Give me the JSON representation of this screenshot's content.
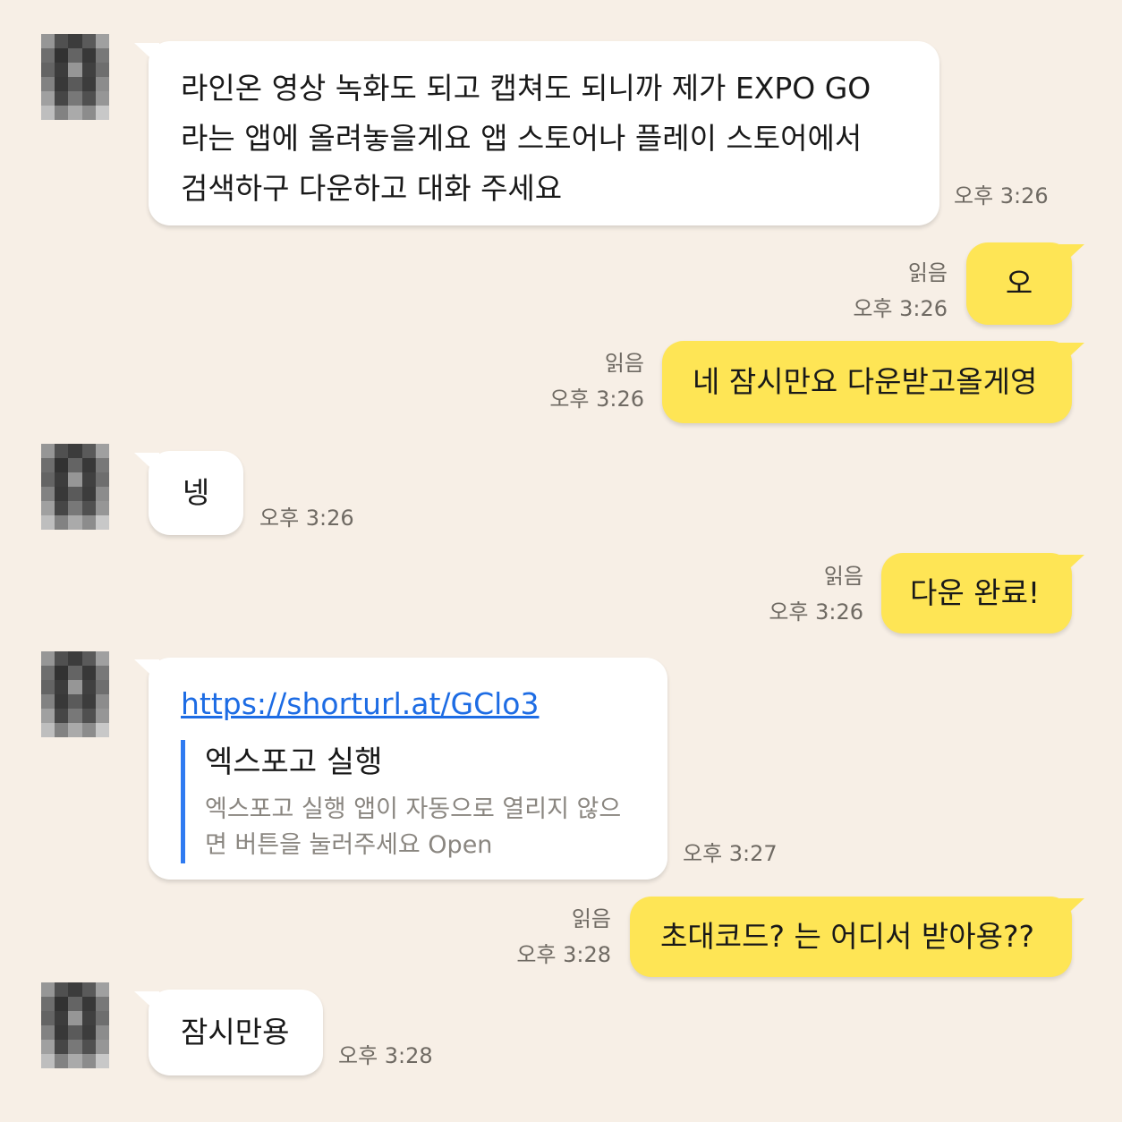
{
  "messages": [
    {
      "side": "in",
      "lines": [
        "라인온 영상 녹화도 되고 캡쳐도 되니까 제가 EXPO GO",
        "라는 앱에 올려놓을게요 앱 스토어나 플레이 스토어에서",
        "검색하구 다운하고 대화 주세요"
      ],
      "time": "오후 3:26"
    },
    {
      "side": "out",
      "text": "오",
      "read": "읽음",
      "time": "오후 3:26"
    },
    {
      "side": "out",
      "text": "네 잠시만요 다운받고올게영",
      "read": "읽음",
      "time": "오후 3:26"
    },
    {
      "side": "in",
      "text": "넹",
      "time": "오후 3:26"
    },
    {
      "side": "out",
      "text": "다운 완료!",
      "read": "읽음",
      "time": "오후 3:26"
    },
    {
      "side": "in",
      "link": {
        "url": "https://shorturl.at/GClo3",
        "title": "엑스포고 실행",
        "desc_lines": [
          "엑스포고 실행 앱이 자동으로 열리지 않으",
          "면 버튼을 눌러주세요 Open"
        ]
      },
      "time": "오후 3:27"
    },
    {
      "side": "out",
      "text": "초대코드? 는 어디서 받아용??",
      "read": "읽음",
      "time": "오후 3:28"
    },
    {
      "side": "in",
      "text": "잠시만용",
      "time": "오후 3:28"
    }
  ],
  "colors": {
    "background": "#f7efe6",
    "incoming_bubble": "#ffffff",
    "outgoing_bubble": "#fee555",
    "link": "#1d6ce4",
    "preview_bar": "#2f7bf1",
    "meta_text": "#6f6a63"
  },
  "avatar": {
    "type": "pixelated-profile-photo"
  }
}
